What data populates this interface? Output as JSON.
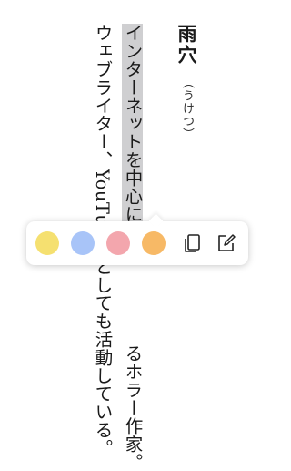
{
  "article": {
    "title": "雨穴",
    "ruby": "（うけつ）",
    "line1": {
      "highlighted": "インターネットを中心に活",
      "rest": "るホラー作家。"
    },
    "line2": "ウェブライター、YouTuberとしても活動している。"
  },
  "toolbar": {
    "colors": [
      "#f5e070",
      "#a8c4f8",
      "#f3a6ad",
      "#f7b966"
    ],
    "icons": [
      "copy-icon",
      "edit-note-icon"
    ]
  }
}
